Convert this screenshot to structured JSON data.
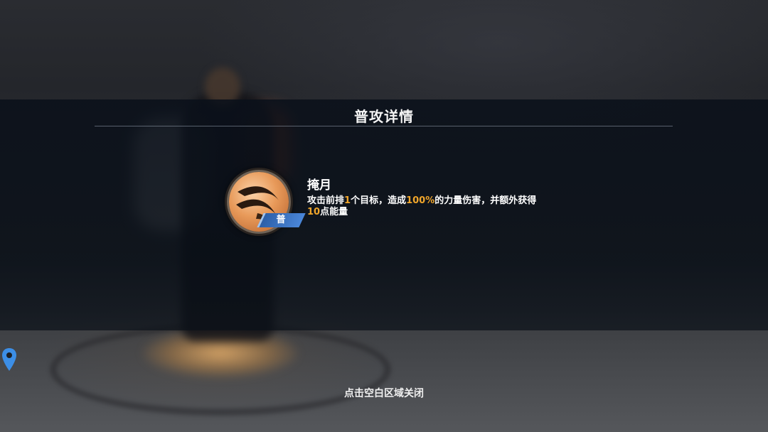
{
  "panel": {
    "title": "普攻详情"
  },
  "skill": {
    "name": "掩月",
    "badge": "普",
    "description_parts": [
      "攻击前排",
      "1",
      "个目标，造成",
      "100%",
      "的力量伤害，并额外获得",
      "10",
      "点能量"
    ],
    "highlight_color": "#f0a52a",
    "icon": "crescent-slash-icon"
  },
  "footer": {
    "close_hint": "点击空白区域关闭"
  },
  "side": {
    "icon": "location-pin-icon"
  },
  "colors": {
    "badge_blue": "#3b74c4",
    "text": "#ffffff"
  }
}
